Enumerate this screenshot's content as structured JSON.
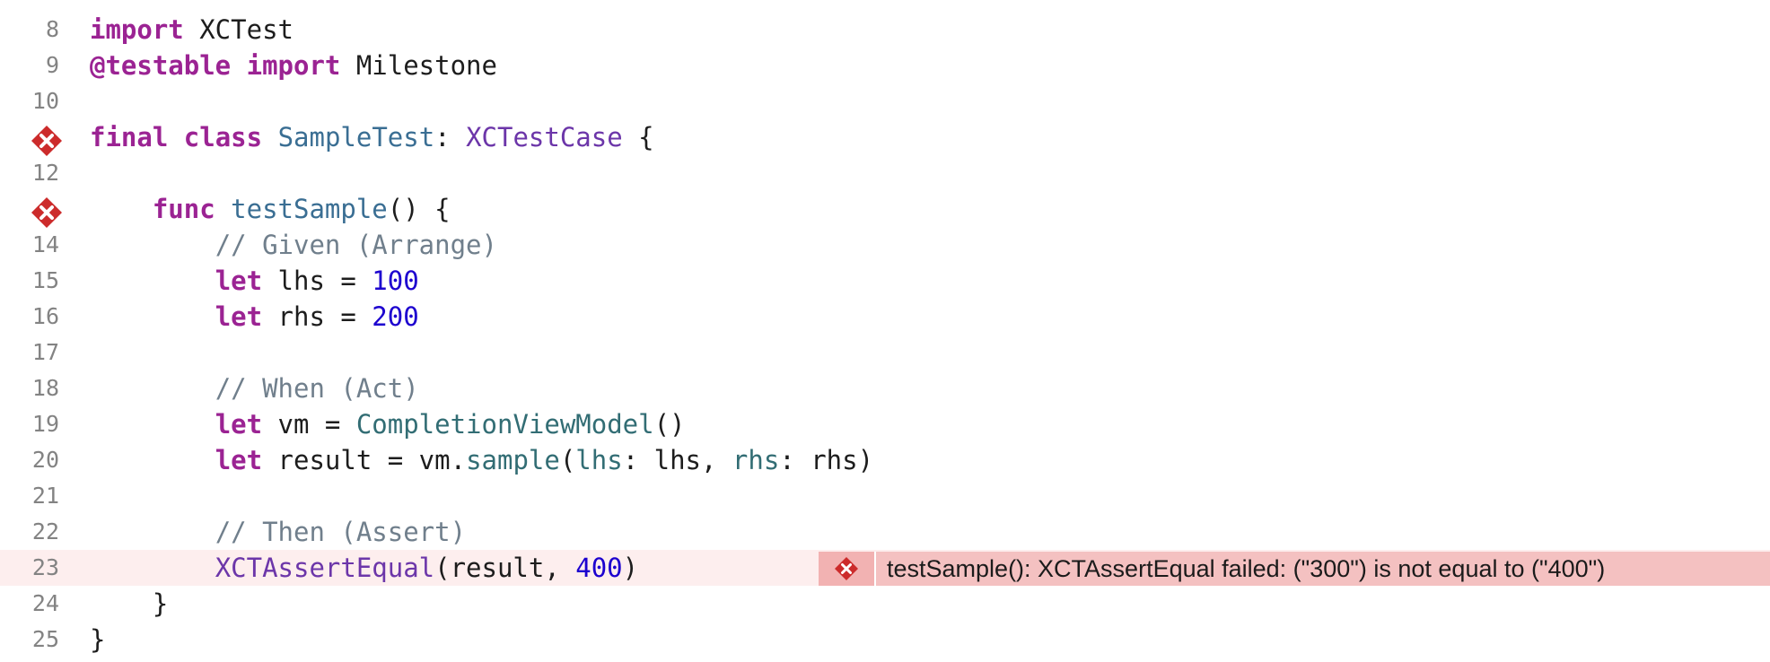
{
  "editor": {
    "lines": [
      {
        "num": "8",
        "tokens": [
          {
            "t": "import",
            "c": "kw"
          },
          {
            "t": " XCTest",
            "c": "plain"
          }
        ]
      },
      {
        "num": "9",
        "tokens": [
          {
            "t": "@testable",
            "c": "kw"
          },
          {
            "t": " ",
            "c": "plain"
          },
          {
            "t": "import",
            "c": "kw"
          },
          {
            "t": " Milestone",
            "c": "plain"
          }
        ]
      },
      {
        "num": "10",
        "tokens": []
      },
      {
        "num": "11",
        "error": true,
        "tokens": [
          {
            "t": "final",
            "c": "kw"
          },
          {
            "t": " ",
            "c": "plain"
          },
          {
            "t": "class",
            "c": "kw"
          },
          {
            "t": " ",
            "c": "plain"
          },
          {
            "t": "SampleTest",
            "c": "type"
          },
          {
            "t": ": ",
            "c": "plain"
          },
          {
            "t": "XCTestCase",
            "c": "ptype"
          },
          {
            "t": " {",
            "c": "plain"
          }
        ]
      },
      {
        "num": "12",
        "tokens": []
      },
      {
        "num": "13",
        "error": true,
        "tokens": [
          {
            "t": "    ",
            "c": "plain"
          },
          {
            "t": "func",
            "c": "kw"
          },
          {
            "t": " ",
            "c": "plain"
          },
          {
            "t": "testSample",
            "c": "type"
          },
          {
            "t": "() {",
            "c": "plain"
          }
        ]
      },
      {
        "num": "14",
        "tokens": [
          {
            "t": "        ",
            "c": "plain"
          },
          {
            "t": "// Given (Arrange)",
            "c": "cmt"
          }
        ]
      },
      {
        "num": "15",
        "tokens": [
          {
            "t": "        ",
            "c": "plain"
          },
          {
            "t": "let",
            "c": "kw"
          },
          {
            "t": " lhs = ",
            "c": "plain"
          },
          {
            "t": "100",
            "c": "num"
          }
        ]
      },
      {
        "num": "16",
        "tokens": [
          {
            "t": "        ",
            "c": "plain"
          },
          {
            "t": "let",
            "c": "kw"
          },
          {
            "t": " rhs = ",
            "c": "plain"
          },
          {
            "t": "200",
            "c": "num"
          }
        ]
      },
      {
        "num": "17",
        "tokens": []
      },
      {
        "num": "18",
        "tokens": [
          {
            "t": "        ",
            "c": "plain"
          },
          {
            "t": "// When (Act)",
            "c": "cmt"
          }
        ]
      },
      {
        "num": "19",
        "tokens": [
          {
            "t": "        ",
            "c": "plain"
          },
          {
            "t": "let",
            "c": "kw"
          },
          {
            "t": " vm = ",
            "c": "plain"
          },
          {
            "t": "CompletionViewModel",
            "c": "fn"
          },
          {
            "t": "()",
            "c": "plain"
          }
        ]
      },
      {
        "num": "20",
        "tokens": [
          {
            "t": "        ",
            "c": "plain"
          },
          {
            "t": "let",
            "c": "kw"
          },
          {
            "t": " result = vm.",
            "c": "plain"
          },
          {
            "t": "sample",
            "c": "fn"
          },
          {
            "t": "(",
            "c": "plain"
          },
          {
            "t": "lhs",
            "c": "fn"
          },
          {
            "t": ": lhs, ",
            "c": "plain"
          },
          {
            "t": "rhs",
            "c": "fn"
          },
          {
            "t": ": rhs)",
            "c": "plain"
          }
        ]
      },
      {
        "num": "21",
        "tokens": []
      },
      {
        "num": "22",
        "tokens": [
          {
            "t": "        ",
            "c": "plain"
          },
          {
            "t": "// Then (Assert)",
            "c": "cmt"
          }
        ]
      },
      {
        "num": "23",
        "highlight": true,
        "tokens": [
          {
            "t": "        ",
            "c": "plain"
          },
          {
            "t": "XCTAssertEqual",
            "c": "ptype"
          },
          {
            "t": "(result, ",
            "c": "plain"
          },
          {
            "t": "400",
            "c": "num"
          },
          {
            "t": ")",
            "c": "plain"
          }
        ]
      },
      {
        "num": "24",
        "tokens": [
          {
            "t": "    }",
            "c": "plain"
          }
        ]
      },
      {
        "num": "25",
        "tokens": [
          {
            "t": "}",
            "c": "plain"
          }
        ]
      }
    ]
  },
  "error_banner": {
    "message": "testSample(): XCTAssertEqual failed: (\"300\") is not equal to (\"400\")",
    "icon": "error-x-icon"
  },
  "colors": {
    "keyword": "#9b2393",
    "type": "#3a6e93",
    "protocol_type": "#6c36a9",
    "number": "#1c00cf",
    "comment": "#707f8c",
    "function": "#326d74",
    "error_red": "#cc2b2b",
    "error_line_bg": "#fdeeee",
    "error_banner_bg": "#f4c1c1"
  }
}
